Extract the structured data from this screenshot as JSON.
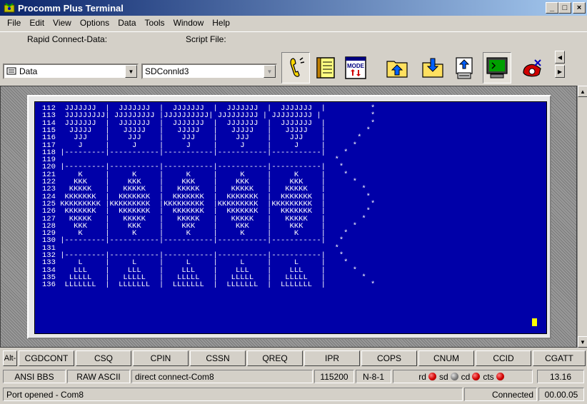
{
  "window": {
    "title": "Procomm Plus Terminal",
    "controls": {
      "minimize": "_",
      "maximize": "□",
      "close": "×"
    }
  },
  "menu": [
    "File",
    "Edit",
    "View",
    "Options",
    "Data",
    "Tools",
    "Window",
    "Help"
  ],
  "toolbar": {
    "rapid_connect_label": "Rapid Connect-Data:",
    "rapid_connect_value": "Data",
    "script_file_label": "Script File:",
    "script_file_value": "SDConnld3",
    "mode_label": "MODE",
    "buttons": [
      "phone-dial-icon",
      "phonebook-icon",
      "mode-icon",
      "send-file-icon",
      "receive-file-icon",
      "upload-icon",
      "terminal-icon",
      "exit-icon"
    ]
  },
  "terminal": {
    "lines": [
      "112  JJJJJJJ  |  JJJJJJJ  |  JJJJJJJ  |  JJJJJJJ  |  JJJJJJJ  |          *",
      "113  JJJJJJJJJ| JJJJJJJJJ |JJJJJJJJJJ| JJJJJJJJJ | JJJJJJJJJ |           *",
      "114  JJJJJJJ  |  JJJJJJJ  |  JJJJJJJ  |  JJJJJJJ  |  JJJJJJJ  |          *",
      "115   JJJJJ   |   JJJJJ   |   JJJJJ   |   JJJJJ   |   JJJJJ   |         *",
      "116    JJJ    |    JJJ    |    JJJ    |    JJJ    |    JJJ    |       *",
      "117     J     |     J     |     J     |     J     |     J     |      *",
      "118 |---------|-----------|-----------|-----------|-----------|    *",
      "119                                                              *",
      "120 |---------|-----------|-----------|-----------|-----------|   *",
      "121     K     |     K     |     K     |     K     |     K     |    *",
      "122    KKK    |    KKK    |    KKK    |    KKK    |    KKK    |      *",
      "123   KKKKK   |   KKKKK   |   KKKKK   |   KKKKK   |   KKKKK   |        *",
      "124  KKKKKKK  |  KKKKKKK  |  KKKKKKK  |  KKKKKKK  |  KKKKKKK  |         *",
      "125 KKKKKKKKK |KKKKKKKKK  |KKKKKKKKK  |KKKKKKKKK  |KKKKKKKKK  |          *",
      "126  KKKKKKK  |  KKKKKKK  |  KKKKKKK  |  KKKKKKK  |  KKKKKKK  |         *",
      "127   KKKKK   |   KKKKK   |   KKKKK   |   KKKKK   |   KKKKK   |        *",
      "128    KKK    |    KKK    |    KKK    |    KKK    |    KKK    |      *",
      "129     K     |     K     |     K     |     K     |     K     |    *",
      "130 |---------|-----------|-----------|-----------|-----------|   *",
      "131                                                              *",
      "132 |---------|-----------|-----------|-----------|-----------|   *",
      "133     L     |     L     |     L     |     L     |     L     |    *",
      "134    LLL    |    LLL    |    LLL    |    LLL    |    LLL    |      *",
      "135   LLLLL   |   LLLLL   |   LLLLL   |   LLLLL   |   LLLLL   |        *",
      "136  LLLLLLL  |  LLLLLLL  |  LLLLLLL  |  LLLLLLL  |  LLLLLLL  |          *"
    ]
  },
  "meta_keys": {
    "alt_label": "Alt-",
    "buttons": [
      "CGDCONT",
      "CSQ",
      "CPIN",
      "CSSN",
      "QREQ",
      "IPR",
      "COPS",
      "CNUM",
      "CCID",
      "CGATT"
    ]
  },
  "status": {
    "emulation": "ANSI BBS",
    "transfer": "RAW ASCII",
    "connection": "direct connect-Com8",
    "baud": "115200",
    "parity": "N-8-1",
    "leds": [
      {
        "label": "rd",
        "state": "red"
      },
      {
        "label": "sd",
        "state": "gray"
      },
      {
        "label": "cd",
        "state": "red"
      },
      {
        "label": "cts",
        "state": "red"
      }
    ],
    "clock": "13.16",
    "message": "Port opened - Com8",
    "connected": "Connected",
    "elapsed": "00.00.05"
  }
}
